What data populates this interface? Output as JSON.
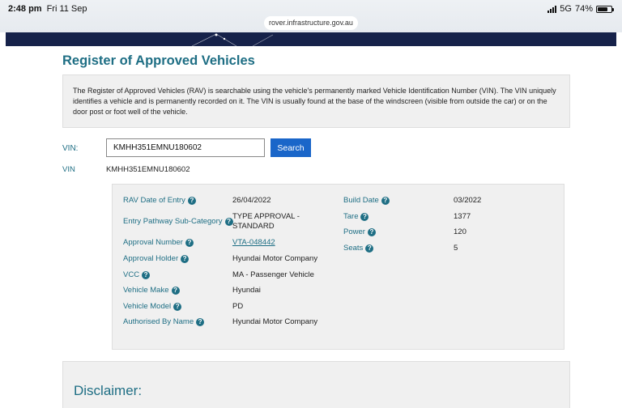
{
  "status_bar": {
    "time": "2:48 pm",
    "date": "Fri 11 Sep",
    "network": "5G",
    "battery": "74%",
    "battery_level": 0.74
  },
  "browser": {
    "url": "rover.infrastructure.gov.au"
  },
  "page": {
    "title": "Register of Approved Vehicles",
    "intro": "The Register of Approved Vehicles (RAV) is searchable using the vehicle's permanently marked Vehicle Identification Number (VIN). The VIN uniquely identifies a vehicle and is permanently recorded on it. The VIN is usually found at the base of the windscreen (visible from outside the car) or on the door post or foot well of the vehicle."
  },
  "search": {
    "vin_label": "VIN:",
    "vin_value": "KMHH351EMNU180602",
    "button": "Search"
  },
  "result_vin": {
    "label": "VIN",
    "value": "KMHH351EMNU180602"
  },
  "details_left": [
    {
      "label": "RAV Date of Entry",
      "value": "26/04/2022"
    },
    {
      "label": "Entry Pathway Sub-Category",
      "value": "TYPE APPROVAL - STANDARD"
    },
    {
      "label": "Approval Number",
      "value": "VTA-048442"
    },
    {
      "label": "Approval Holder",
      "value": "Hyundai Motor Company"
    },
    {
      "label": "VCC",
      "value": "MA - Passenger Vehicle"
    },
    {
      "label": "Vehicle Make",
      "value": "Hyundai"
    },
    {
      "label": "Vehicle Model",
      "value": "PD"
    },
    {
      "label": "Authorised By Name",
      "value": "Hyundai Motor Company"
    }
  ],
  "details_right": [
    {
      "label": "Build Date",
      "value": "03/2022"
    },
    {
      "label": "Tare",
      "value": "1377"
    },
    {
      "label": "Power",
      "value": "120"
    },
    {
      "label": "Seats",
      "value": "5"
    }
  ],
  "disclaimer": {
    "title": "Disclaimer:"
  },
  "icons": {
    "help": "question-circle-icon",
    "signal": "cell-signal-icon",
    "battery": "battery-icon"
  },
  "colors": {
    "accent": "#1e6e84",
    "button": "#1a66c9",
    "header": "#16224a"
  }
}
